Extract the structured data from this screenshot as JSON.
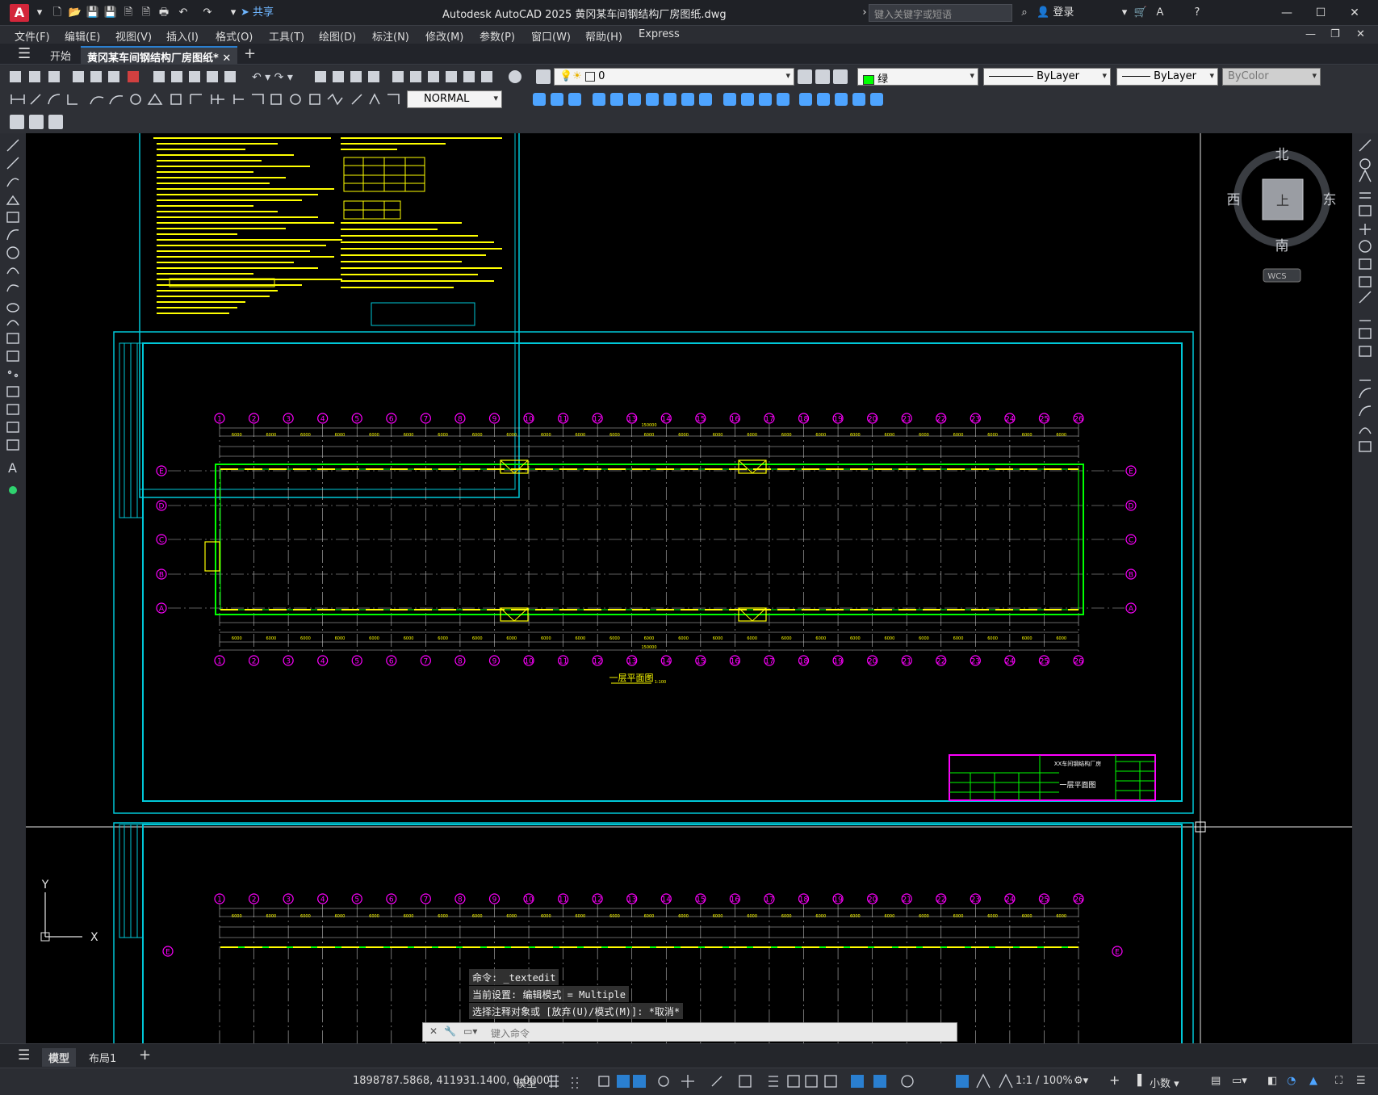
{
  "window": {
    "title": "Autodesk AutoCAD 2025    黄冈某车间钢结构厂房图纸.dwg",
    "app_logo": "A",
    "share_label": "共享",
    "search_placeholder": "键入关键字或短语",
    "login_label": "登录"
  },
  "menu": [
    "文件(F)",
    "编辑(E)",
    "视图(V)",
    "插入(I)",
    "格式(O)",
    "工具(T)",
    "绘图(D)",
    "标注(N)",
    "修改(M)",
    "参数(P)",
    "窗口(W)",
    "帮助(H)",
    "Express"
  ],
  "tabs": {
    "start": "开始",
    "active": "黄冈某车间钢结构厂房图纸*"
  },
  "toolbar": {
    "layer_value": "0",
    "color_value": "绿",
    "linetype_value": "ByLayer",
    "lineweight_value": "ByLayer",
    "plotstyle_value": "ByColor",
    "dimstyle_value": "NORMAL"
  },
  "viewcube": {
    "north": "北",
    "south": "南",
    "east": "东",
    "west": "西",
    "face": "上",
    "ucs": "WCS"
  },
  "drawing": {
    "plan_title": "一层平面图",
    "plan_scale": "1:100",
    "grid_numbers": [
      "1",
      "2",
      "3",
      "4",
      "5",
      "6",
      "7",
      "8",
      "9",
      "10",
      "11",
      "12",
      "13",
      "14",
      "15",
      "16",
      "17",
      "18",
      "19",
      "20",
      "21",
      "22",
      "23",
      "24",
      "25",
      "26"
    ],
    "grid_letters": [
      "E",
      "D",
      "C",
      "B",
      "A"
    ],
    "total_dim": "150000",
    "bay_dim": "6000",
    "titleblock_name": "一层平面图",
    "project_name": "XX车间钢结构厂房"
  },
  "command": {
    "line1": "命令: _textedit",
    "line2": "当前设置: 编辑模式 = Multiple",
    "line3": "选择注释对象或 [放弃(U)/模式(M)]: *取消*",
    "input_placeholder": "键入命令"
  },
  "ucs_icon": {
    "x": "X",
    "y": "Y"
  },
  "layout_tabs": [
    "模型",
    "布局1"
  ],
  "status": {
    "coords": "1898787.5868, 411931.1400, 0.0000",
    "model": "模型",
    "scale": "1:1 / 100%",
    "units": "小数"
  },
  "colors": {
    "frame": "#00c8d8",
    "drawing_text": "#ffff00",
    "grid_bubble": "#ff00ff",
    "wall": "#00ff00",
    "accent": "#2a7fd0"
  }
}
